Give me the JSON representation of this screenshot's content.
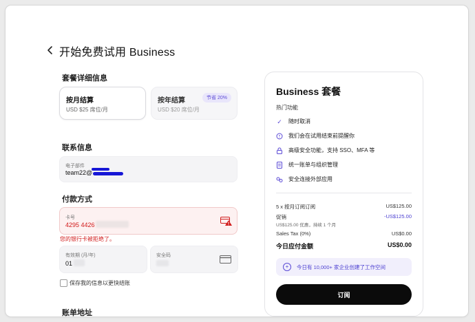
{
  "header": {
    "title": "开始免费试用 Business"
  },
  "plan": {
    "section_title": "套餐详细信息",
    "monthly": {
      "name": "按月结算",
      "price": "USD $25 席位/月"
    },
    "yearly": {
      "name": "按年结算",
      "price": "USD $20 席位/月",
      "badge": "节省 20%"
    }
  },
  "contact": {
    "section_title": "联系信息",
    "email_label": "电子部件",
    "email_value": "team22@"
  },
  "payment": {
    "section_title": "付款方式",
    "card_label": "卡号",
    "card_value": "4295 4426",
    "error": "您的银行卡被拒绝了。",
    "expiry_label": "有效期 (月/年)",
    "expiry_value": "01",
    "cvc_label": "安全码",
    "save_info": "保存我的信息以更快结账"
  },
  "billing": {
    "section_title": "账单地址"
  },
  "summary": {
    "title": "Business 套餐",
    "features_title": "热门功能",
    "features": [
      {
        "icon": "check-icon",
        "text": "随时取消"
      },
      {
        "icon": "clock-icon",
        "text": "我们会在试用结束前提醒你"
      },
      {
        "icon": "lock-icon",
        "text": "高级安全功能，支持 SSO、MFA 等"
      },
      {
        "icon": "document-icon",
        "text": "统一账单与组织管理"
      },
      {
        "icon": "link-icon",
        "text": "安全连接外部应用"
      }
    ],
    "lines": {
      "subscription_label": "5 x 按月订阅订阅",
      "subscription_value": "US$125.00",
      "promo_label": "促销",
      "promo_value": "-US$125.00",
      "promo_note": "US$125.00 优惠，持续 1 个月",
      "tax_label": "Sales Tax (0%)",
      "tax_value": "US$0.00",
      "total_label": "今日应付金额",
      "total_value": "US$0.00"
    },
    "promo_banner": "今日有 10,000+ 家企业创建了工作空间",
    "subscribe_label": "订阅"
  }
}
